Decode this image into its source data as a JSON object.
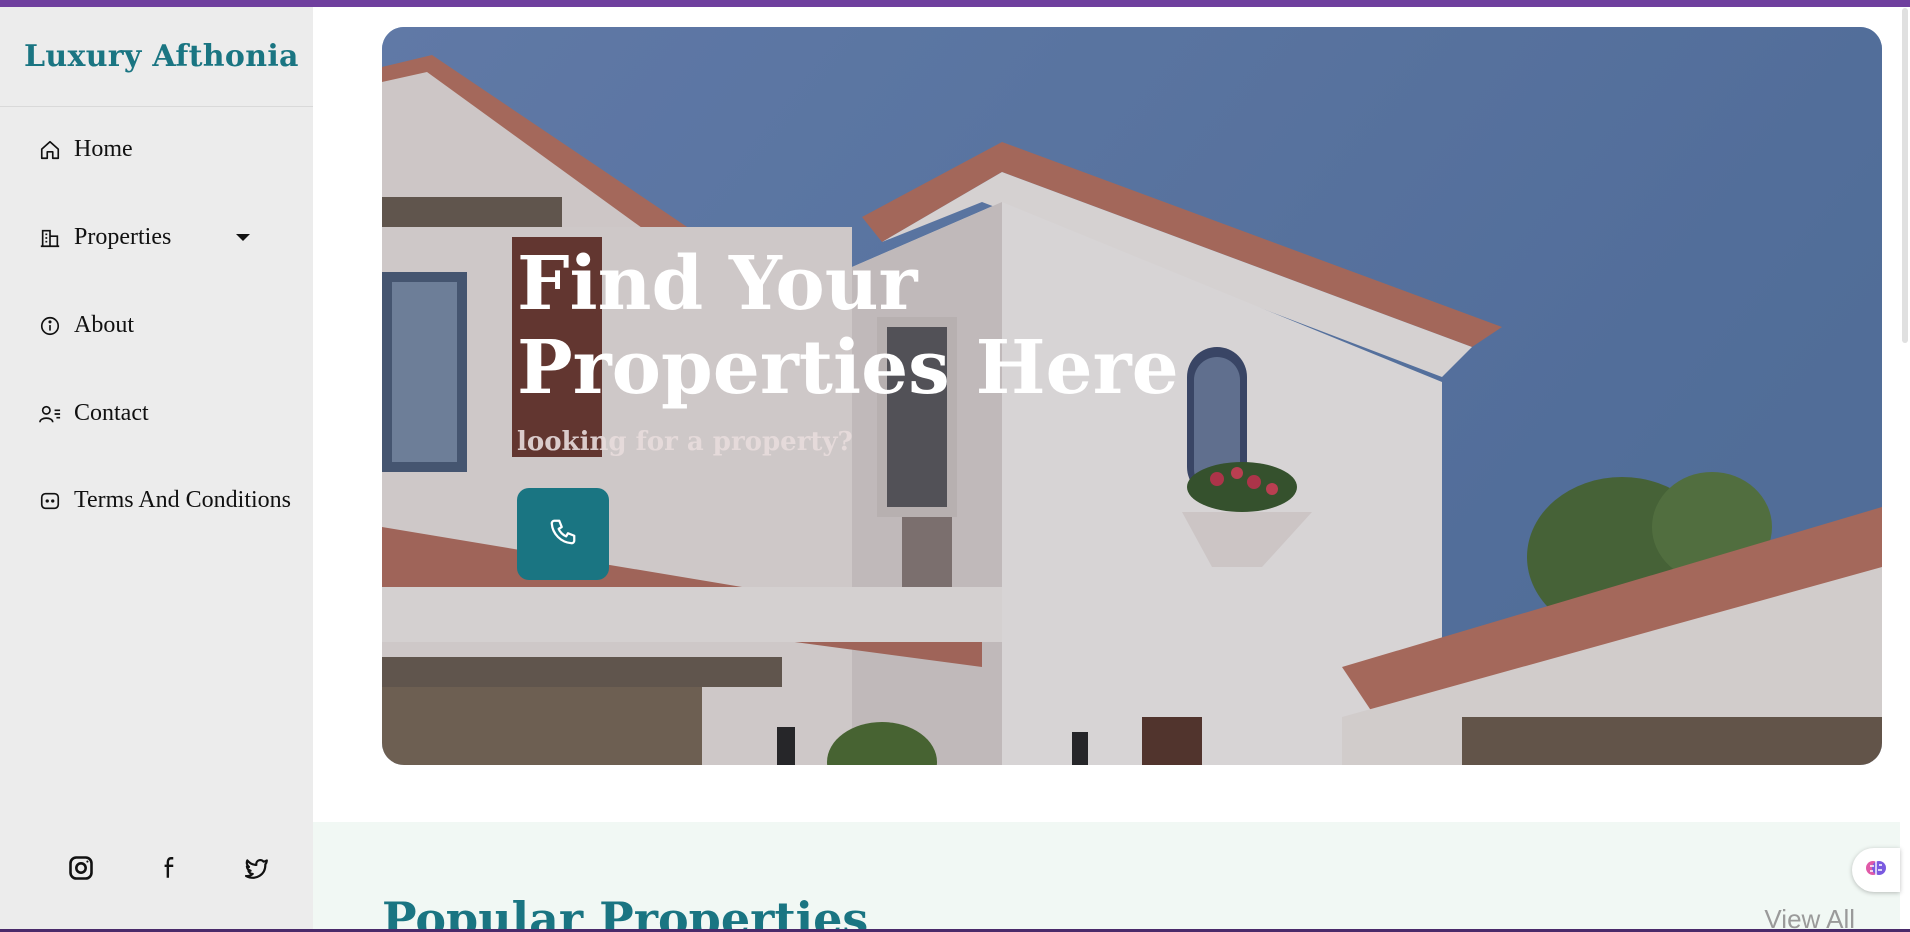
{
  "brand": {
    "name": "Luxury Afthonia",
    "color": "#1a7582"
  },
  "sidebar": {
    "items": [
      {
        "label": "Home",
        "icon": "home-icon"
      },
      {
        "label": "Properties",
        "icon": "building-icon",
        "has_dropdown": true
      },
      {
        "label": "About",
        "icon": "info-icon"
      },
      {
        "label": "Contact",
        "icon": "contact-icon"
      },
      {
        "label": "Terms And Conditions",
        "icon": "chat-icon"
      }
    ],
    "socials": [
      "instagram-icon",
      "facebook-icon",
      "twitter-icon"
    ]
  },
  "hero": {
    "title_line1": "Find Your",
    "title_line2": "Properties Here",
    "subtitle": "looking for a property?",
    "call_button_icon": "phone-icon"
  },
  "popular": {
    "title": "Popular Properties",
    "view_all": "View All"
  },
  "colors": {
    "accent": "#1a7582",
    "top_bar": "#6f3f9e",
    "sidebar_bg": "#ececec",
    "section_bg": "#f1f8f4"
  }
}
